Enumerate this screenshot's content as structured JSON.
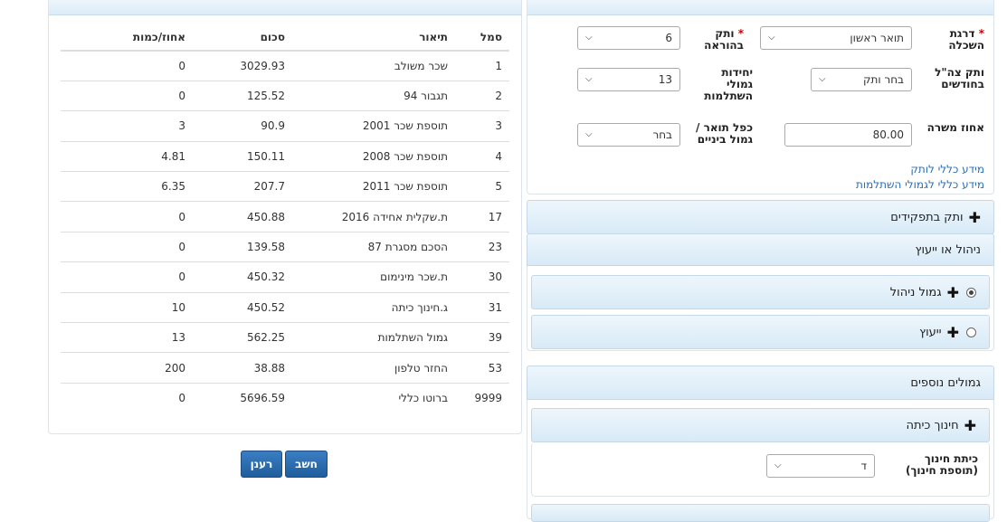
{
  "form": {
    "education_label": "דרגת השכלה",
    "education_value": "תואר ראשון",
    "teaching_seniority_label": "ותק בהוראה",
    "teaching_seniority_value": "6",
    "idf_seniority_label": "ותק צה\"ל בחודשים",
    "idf_seniority_value": "בחר ותק",
    "training_units_label": "יחידות גמולי השתלמות",
    "training_units_value": "13",
    "position_percent_label": "אחוז משרה",
    "position_percent_value": "80.00",
    "double_degree_label": "כפל תואר / גמול ביניים",
    "double_degree_value": "בחר",
    "link_seniority": "מידע כללי לותק",
    "link_training": "מידע כללי לגמולי השתלמות"
  },
  "sections": {
    "roles_seniority": "ותק בתפקידים",
    "management_or_advice": "ניהול או ייעוץ",
    "management_bonus": "גמול ניהול",
    "advice": "ייעוץ",
    "additional_bonuses": "גמולים נוספים",
    "class_education": "חינוך כיתה",
    "class_label": "כיתת חינוך (תוספת חינוך)",
    "class_value": "ד"
  },
  "table": {
    "headers": [
      "סמל",
      "תיאור",
      "סכום",
      "אחוז/כמות"
    ],
    "rows": [
      [
        "1",
        "שכר משולב",
        "3029.93",
        "0"
      ],
      [
        "2",
        "תגבור 94",
        "125.52",
        "0"
      ],
      [
        "3",
        "תוספת שכר 2001",
        "90.9",
        "3"
      ],
      [
        "4",
        "תוספת שכר 2008",
        "150.11",
        "4.81"
      ],
      [
        "5",
        "תוספת שכר 2011",
        "207.7",
        "6.35"
      ],
      [
        "17",
        "ת.שקלית אחידה 2016",
        "450.88",
        "0"
      ],
      [
        "23",
        "הסכם מסגרת 87",
        "139.58",
        "0"
      ],
      [
        "30",
        "ת.שכר מינימום",
        "450.32",
        "0"
      ],
      [
        "31",
        "ג.חינוך כיתה",
        "450.52",
        "10"
      ],
      [
        "39",
        "גמול השתלמות",
        "562.25",
        "13"
      ],
      [
        "53",
        "החזר טלפון",
        "38.88",
        "200"
      ],
      [
        "9999",
        "ברוטו כללי",
        "5696.59",
        "0"
      ]
    ]
  },
  "buttons": {
    "calculate": "חשב",
    "refresh": "רענן"
  }
}
